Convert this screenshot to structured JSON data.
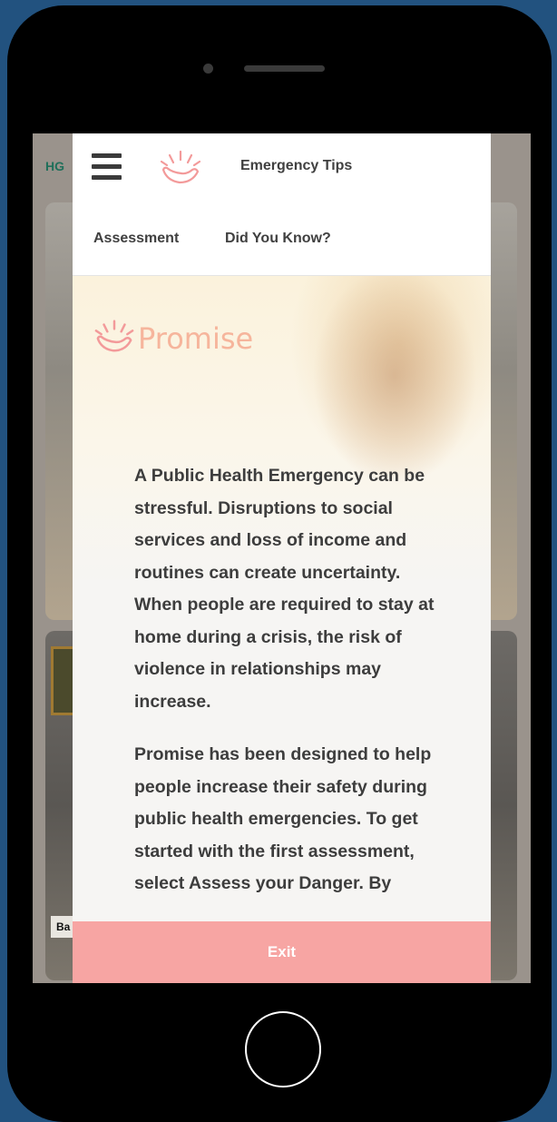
{
  "header": {
    "menu_icon": "hamburger-icon",
    "logo_icon": "sun-logo-icon",
    "emergency_tips_label": "Emergency Tips",
    "assessment_label": "Assessment",
    "did_you_know_label": "Did You Know?"
  },
  "brand": {
    "name": "Promise",
    "icon": "sun-logo-icon"
  },
  "content": {
    "paragraph_1": "A Public Health Emergency can be stressful. Disruptions to social services and loss of income and routines can create uncertainty. When people are required to stay at home during a crisis, the risk of violence in relationships may increase.",
    "paragraph_2": "Promise has been designed to help people increase their safety during public health emergencies. To get started with the first assessment, select Assess your Danger. By"
  },
  "footer": {
    "exit_label": "Exit"
  },
  "background": {
    "site_logo": "HG",
    "caption": "Ba T"
  },
  "colors": {
    "accent_pink": "#f7a5a3",
    "brand_peach": "#f6b59c",
    "text_dark": "#3d3d3d"
  }
}
